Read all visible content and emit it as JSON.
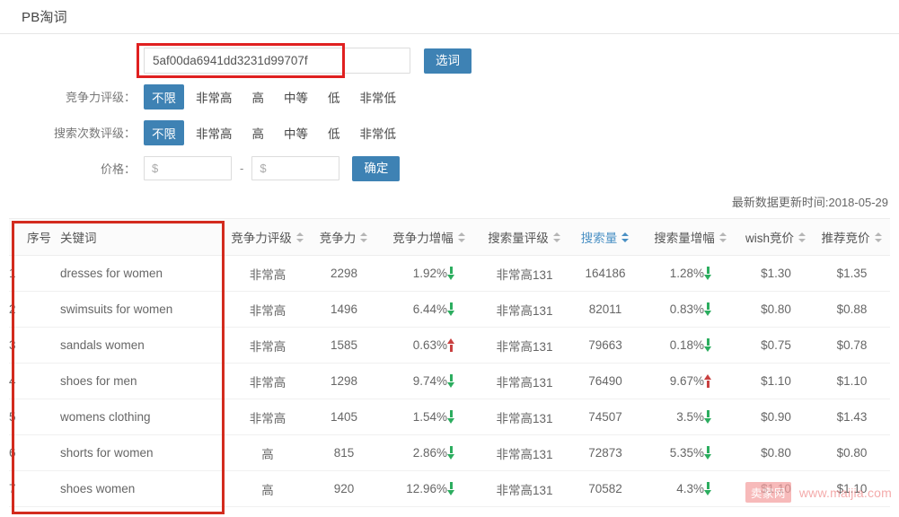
{
  "header": {
    "app_title": "PB淘词"
  },
  "filters": {
    "keyword": {
      "value": "5af00da6941dd3231d99707f",
      "placeholder": "",
      "submit_label": "选词"
    },
    "competition": {
      "label": "竞争力评级：",
      "options": [
        "不限",
        "非常高",
        "高",
        "中等",
        "低",
        "非常低"
      ],
      "selected": "不限"
    },
    "search_count": {
      "label": "搜索次数评级：",
      "options": [
        "不限",
        "非常高",
        "高",
        "中等",
        "低",
        "非常低"
      ],
      "selected": "不限"
    },
    "price": {
      "label": "价格：",
      "min_placeholder": "$",
      "min_value": "",
      "max_placeholder": "$",
      "max_value": "",
      "separator": "-",
      "submit_label": "确定"
    }
  },
  "meta": {
    "update_time": "最新数据更新时间:2018-05-29"
  },
  "table": {
    "columns": [
      {
        "key": "idx",
        "label": "序号",
        "sortable": false,
        "sorted": false
      },
      {
        "key": "keyword",
        "label": "关键词",
        "sortable": false,
        "sorted": false
      },
      {
        "key": "comp_level",
        "label": "竞争力评级",
        "sortable": true,
        "sorted": false
      },
      {
        "key": "comp",
        "label": "竞争力",
        "sortable": true,
        "sorted": false
      },
      {
        "key": "comp_chg",
        "label": "竞争力增幅",
        "sortable": true,
        "sorted": false
      },
      {
        "key": "sv_level",
        "label": "搜索量评级",
        "sortable": true,
        "sorted": false
      },
      {
        "key": "sv",
        "label": "搜索量",
        "sortable": true,
        "sorted": true
      },
      {
        "key": "sv_chg",
        "label": "搜索量增幅",
        "sortable": true,
        "sorted": false
      },
      {
        "key": "wish_bid",
        "label": "wish竞价",
        "sortable": true,
        "sorted": false
      },
      {
        "key": "rec_bid",
        "label": "推荐竞价",
        "sortable": true,
        "sorted": false
      }
    ],
    "rows": [
      {
        "idx": "1",
        "keyword": "dresses for women",
        "comp_level": "非常高",
        "comp": "2298",
        "comp_chg": "1.92%",
        "comp_chg_dir": "down",
        "sv_level": "非常高131",
        "sv": "164186",
        "sv_chg": "1.28%",
        "sv_chg_dir": "down",
        "wish_bid": "$1.30",
        "rec_bid": "$1.35"
      },
      {
        "idx": "2",
        "keyword": "swimsuits for women",
        "comp_level": "非常高",
        "comp": "1496",
        "comp_chg": "6.44%",
        "comp_chg_dir": "down",
        "sv_level": "非常高131",
        "sv": "82011",
        "sv_chg": "0.83%",
        "sv_chg_dir": "down",
        "wish_bid": "$0.80",
        "rec_bid": "$0.88"
      },
      {
        "idx": "3",
        "keyword": "sandals women",
        "comp_level": "非常高",
        "comp": "1585",
        "comp_chg": "0.63%",
        "comp_chg_dir": "up",
        "sv_level": "非常高131",
        "sv": "79663",
        "sv_chg": "0.18%",
        "sv_chg_dir": "down",
        "wish_bid": "$0.75",
        "rec_bid": "$0.78"
      },
      {
        "idx": "4",
        "keyword": "shoes for men",
        "comp_level": "非常高",
        "comp": "1298",
        "comp_chg": "9.74%",
        "comp_chg_dir": "down",
        "sv_level": "非常高131",
        "sv": "76490",
        "sv_chg": "9.67%",
        "sv_chg_dir": "up",
        "wish_bid": "$1.10",
        "rec_bid": "$1.10"
      },
      {
        "idx": "5",
        "keyword": "womens clothing",
        "comp_level": "非常高",
        "comp": "1405",
        "comp_chg": "1.54%",
        "comp_chg_dir": "down",
        "sv_level": "非常高131",
        "sv": "74507",
        "sv_chg": "3.5%",
        "sv_chg_dir": "down",
        "wish_bid": "$0.90",
        "rec_bid": "$1.43"
      },
      {
        "idx": "6",
        "keyword": "shorts for women",
        "comp_level": "高",
        "comp": "815",
        "comp_chg": "2.86%",
        "comp_chg_dir": "down",
        "sv_level": "非常高131",
        "sv": "72873",
        "sv_chg": "5.35%",
        "sv_chg_dir": "down",
        "wish_bid": "$0.80",
        "rec_bid": "$0.80"
      },
      {
        "idx": "7",
        "keyword": "shoes women",
        "comp_level": "高",
        "comp": "920",
        "comp_chg": "12.96%",
        "comp_chg_dir": "down",
        "sv_level": "非常高131",
        "sv": "70582",
        "sv_chg": "4.3%",
        "sv_chg_dir": "down",
        "wish_bid": "$1.10",
        "rec_bid": "$1.10"
      }
    ]
  },
  "watermark": {
    "badge": "卖家网",
    "url": "www.maijia.com"
  },
  "colors": {
    "accent_blue": "#3e82b4",
    "sorted_blue": "#4a90c4",
    "down_green": "#2cad5f",
    "up_red": "#c0392b",
    "annotation_red": "#d32b1e"
  }
}
